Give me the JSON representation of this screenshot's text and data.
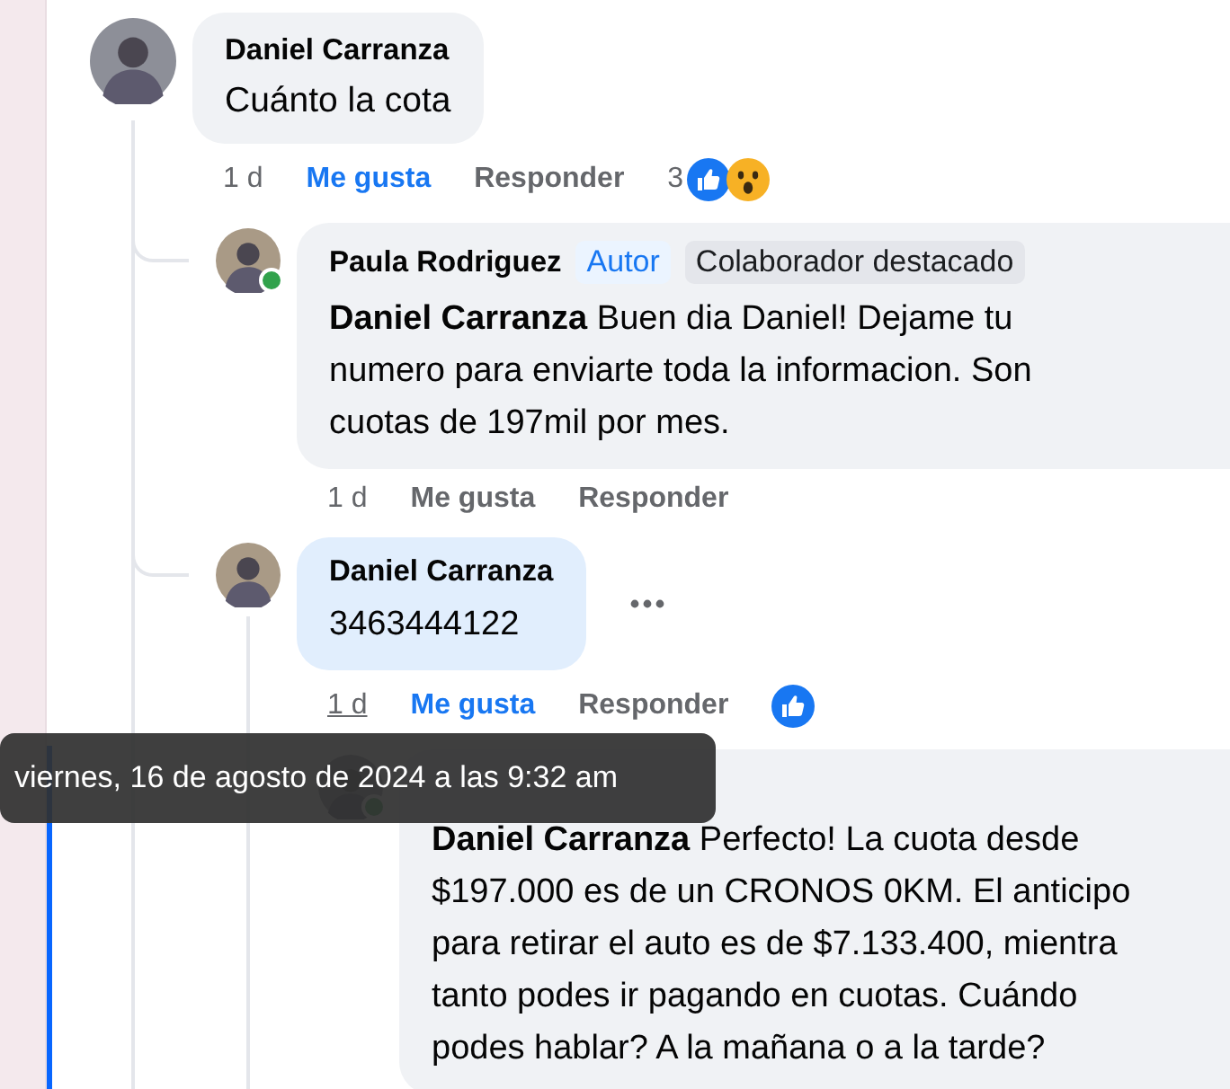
{
  "comments": [
    {
      "author": "Daniel Carranza",
      "text": "Cuánto la cota",
      "time": "1 d",
      "like_label": "Me gusta",
      "liked": true,
      "reply_label": "Responder",
      "reaction_count": "3",
      "reactions": [
        {
          "kind": "like"
        },
        {
          "kind": "wow"
        }
      ],
      "children": [
        {
          "author": "Paula Rodriguez",
          "badges": [
            {
              "label": "Autor",
              "kind": "author"
            },
            {
              "label": "Colaborador destacado",
              "kind": "highlight"
            }
          ],
          "text": "**Daniel Carranza** Buen dia Daniel! Dejame tu\nnumero para enviarte toda la informacion. Son\ncuotas de 197mil por mes.",
          "online": true,
          "time": "1 d",
          "like_label": "Me gusta",
          "liked": false,
          "reply_label": "Responder"
        },
        {
          "author": "Daniel Carranza",
          "text": "3463444122",
          "highlighted": true,
          "more_menu": true,
          "time": "1 d",
          "time_hovered": true,
          "like_label": "Me gusta",
          "liked": true,
          "reply_label": "Responder",
          "reactions": [
            {
              "kind": "like"
            }
          ],
          "children": [
            {
              "text": "**Daniel Carranza** Perfecto! La cuota desde\n$197.000 es de un CRONOS 0KM. El anticipo\npara retirar el auto es de $7.133.400, mientra\ntanto podes ir pagando en cuotas. Cuándo\npodes hablar? A la mañana o a la tarde?",
              "online": true
            }
          ]
        }
      ]
    }
  ],
  "tooltip": {
    "text": "viernes, 16 de agosto de 2024 a las 9:32 am"
  }
}
